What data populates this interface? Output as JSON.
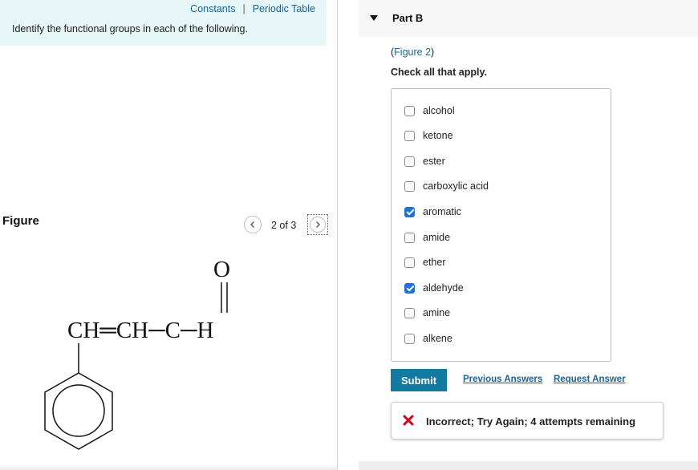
{
  "header": {
    "constants_link": "Constants",
    "separator": "|",
    "periodic_table_link": "Periodic Table",
    "instructions": "Identify the functional groups in each of the following."
  },
  "figure": {
    "label": "Figure",
    "pager": "2 of 3",
    "molecule": {
      "oxygen": "O",
      "carbon": "C",
      "hydrogen": "H",
      "chain": "CH═CH─C─H"
    }
  },
  "part": {
    "title": "Part B",
    "figure_ref_prefix": "(",
    "figure_ref_link": "Figure 2",
    "figure_ref_suffix": ")",
    "instruction": "Check all that apply."
  },
  "options": [
    {
      "label": "alcohol",
      "checked": false
    },
    {
      "label": "ketone",
      "checked": false
    },
    {
      "label": "ester",
      "checked": false
    },
    {
      "label": "carboxylic acid",
      "checked": false
    },
    {
      "label": "aromatic",
      "checked": true
    },
    {
      "label": "amide",
      "checked": false
    },
    {
      "label": "ether",
      "checked": false
    },
    {
      "label": "aldehyde",
      "checked": true
    },
    {
      "label": "amine",
      "checked": false
    },
    {
      "label": "alkene",
      "checked": false
    }
  ],
  "actions": {
    "submit": "Submit",
    "previous_answers": "Previous Answers",
    "request_answer": "Request Answer"
  },
  "feedback": {
    "message": "Incorrect; Try Again; 4 attempts remaining",
    "icon": "x-icon",
    "icon_color": "#d0021b"
  },
  "colors": {
    "accent": "#127aa0",
    "link": "#1a6496",
    "checkbox_checked": "#1f72d4",
    "intro_bg": "#e6f5f5"
  }
}
